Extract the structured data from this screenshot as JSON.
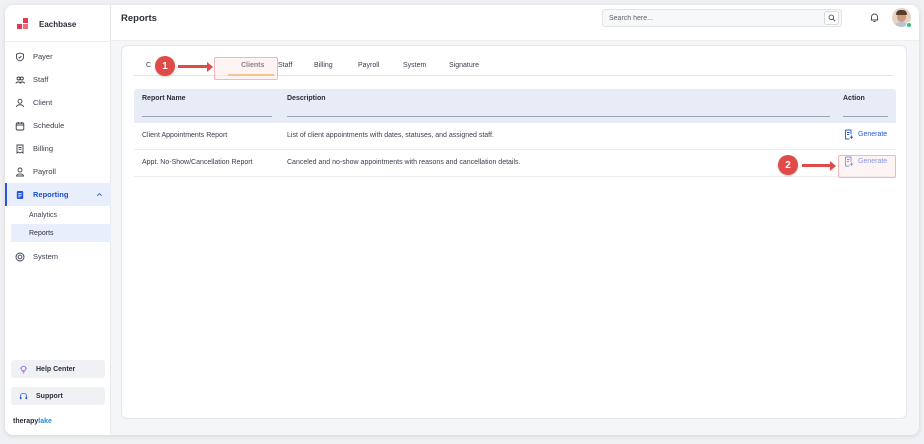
{
  "brand": {
    "name": "Eachbase"
  },
  "header": {
    "title": "Reports",
    "search_placeholder": "Search here..."
  },
  "sidebar": {
    "items": [
      {
        "label": "Payer"
      },
      {
        "label": "Staff"
      },
      {
        "label": "Client"
      },
      {
        "label": "Schedule"
      },
      {
        "label": "Billing"
      },
      {
        "label": "Payroll"
      },
      {
        "label": "Reporting"
      },
      {
        "label": "System"
      }
    ],
    "subitems": [
      {
        "label": "Analytics"
      },
      {
        "label": "Reports"
      }
    ],
    "help_label": "Help Center",
    "support_label": "Support",
    "footer_brand_a": "therapy",
    "footer_brand_b": "lake"
  },
  "tabs": [
    {
      "label": "Clients"
    },
    {
      "label": "Staff"
    },
    {
      "label": "Billing"
    },
    {
      "label": "Payroll"
    },
    {
      "label": "System"
    },
    {
      "label": "Signature"
    }
  ],
  "hidden_tab_fragment": "C",
  "table": {
    "headers": {
      "name": "Report Name",
      "description": "Description",
      "action": "Action"
    },
    "rows": [
      {
        "name": "Client Appointments Report",
        "description": "List of client appointments with dates, statuses, and assigned staff.",
        "action": "Generate"
      },
      {
        "name": "Appt. No-Show/Cancellation Report",
        "description": "Canceled and no-show appointments with reasons and cancellation details.",
        "action": "Generate"
      }
    ]
  },
  "annotations": {
    "step1": "1",
    "step2": "2"
  },
  "colors": {
    "accent": "#2557d6",
    "tab_underline": "#f0a84a",
    "annotation": "#e04b48",
    "brand": "#e53950"
  }
}
